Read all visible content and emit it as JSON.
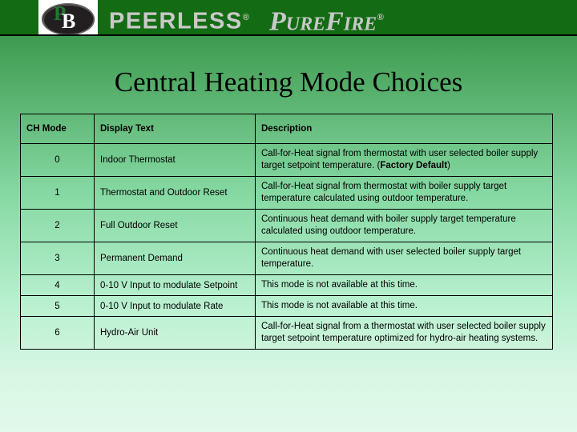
{
  "banner": {
    "logo": {
      "alt": "Peerless Boilers PB logo",
      "letter_1": "P",
      "letter_2": "B"
    },
    "brand_primary": "PEERLESS",
    "brand_primary_mark": "®",
    "brand_secondary": "PureFire",
    "brand_secondary_mark": "®",
    "colors": {
      "banner_bg": "#136b13",
      "brand_text": "#c9c9c9"
    }
  },
  "title": "Central Heating Mode Choices",
  "table": {
    "headers": [
      "CH Mode",
      "Display Text",
      "Description"
    ],
    "rows": [
      {
        "mode": "0",
        "display_text": "Indoor Thermostat",
        "description_pre": "Call-for-Heat signal from thermostat with user selected boiler supply target setpoint temperature. (",
        "description_bold": "Factory Default",
        "description_post": ")"
      },
      {
        "mode": "1",
        "display_text": "Thermostat and Outdoor Reset",
        "description_pre": "Call-for-Heat signal from thermostat with boiler supply target temperature calculated using outdoor temperature.",
        "description_bold": "",
        "description_post": ""
      },
      {
        "mode": "2",
        "display_text": "Full Outdoor Reset",
        "description_pre": "Continuous heat demand with boiler supply target temperature calculated using outdoor temperature.",
        "description_bold": "",
        "description_post": ""
      },
      {
        "mode": "3",
        "display_text": "Permanent Demand",
        "description_pre": "Continuous heat demand with user selected boiler supply target temperature.",
        "description_bold": "",
        "description_post": ""
      },
      {
        "mode": "4",
        "display_text": "0-10 V Input to modulate Setpoint",
        "description_pre": "This mode is not available at this time.",
        "description_bold": "",
        "description_post": ""
      },
      {
        "mode": "5",
        "display_text": " 0-10 V Input to modulate Rate",
        "description_pre": "This mode is not available at this time.",
        "description_bold": "",
        "description_post": ""
      },
      {
        "mode": "6",
        "display_text": "Hydro-Air Unit",
        "description_pre": "Call-for-Heat signal from a thermostat with user selected boiler supply target setpoint temperature optimized for hydro-air heating systems.",
        "description_bold": "",
        "description_post": ""
      }
    ]
  },
  "colors": {
    "background_top": "#2e8b40",
    "background_bottom": "#e2f9ec",
    "table_border": "#000000",
    "text": "#000000"
  }
}
